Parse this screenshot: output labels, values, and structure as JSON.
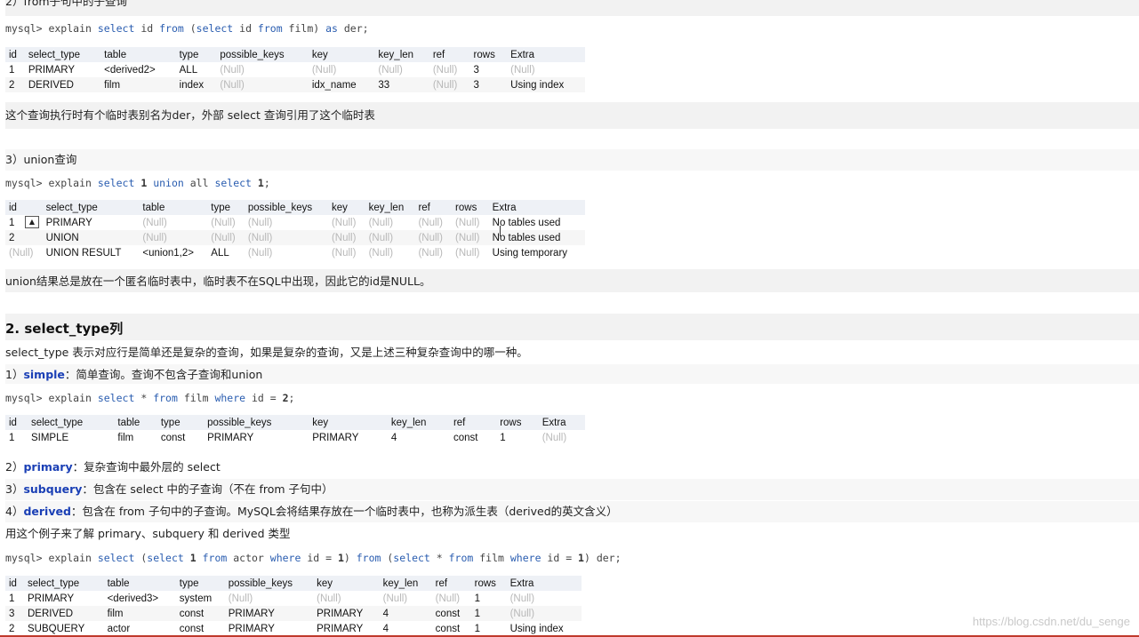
{
  "section_from": {
    "heading": "2）from子句中的子查询",
    "code_prefix": "mysql> explain ",
    "code_k1": "select",
    "code_t1": " id ",
    "code_k2": "from",
    "code_t2": " (",
    "code_k3": "select",
    "code_t3": " id ",
    "code_k4": "from",
    "code_t4": " film) ",
    "code_k5": "as",
    "code_t5": " der;",
    "table": {
      "headers": [
        "id",
        "select_type",
        "table",
        "type",
        "possible_keys",
        "key",
        "key_len",
        "ref",
        "rows",
        "Extra"
      ],
      "rows": [
        [
          "1",
          "PRIMARY",
          "<derived2>",
          "ALL",
          "(Null)",
          "(Null)",
          "(Null)",
          "(Null)",
          "3",
          "(Null)"
        ],
        [
          "2",
          "DERIVED",
          "film",
          "index",
          "(Null)",
          "idx_name",
          "33",
          "(Null)",
          "3",
          "Using index"
        ]
      ]
    },
    "note": "这个查询执行时有个临时表别名为der，外部 select 查询引用了这个临时表"
  },
  "section_union": {
    "heading": "3）union查询",
    "code_prefix": "mysql> explain ",
    "code_k1": "select",
    "code_n1": " 1 ",
    "code_k2": "union",
    "code_t2": " all ",
    "code_k3": "select",
    "code_n2": " 1",
    "code_t3": ";",
    "table": {
      "headers": [
        "id",
        "select_type",
        "table",
        "type",
        "possible_keys",
        "key",
        "key_len",
        "ref",
        "rows",
        "Extra"
      ],
      "rows": [
        [
          "1",
          "PRIMARY",
          "(Null)",
          "(Null)",
          "(Null)",
          "(Null)",
          "(Null)",
          "(Null)",
          "(Null)",
          "No tables used"
        ],
        [
          "2",
          "UNION",
          "(Null)",
          "(Null)",
          "(Null)",
          "(Null)",
          "(Null)",
          "(Null)",
          "(Null)",
          "No tables used"
        ],
        [
          "(Null)",
          "UNION RESULT",
          "<union1,2>",
          "ALL",
          "(Null)",
          "(Null)",
          "(Null)",
          "(Null)",
          "(Null)",
          "Using temporary"
        ]
      ]
    },
    "note": "union结果总是放在一个匿名临时表中，临时表不在SQL中出现，因此它的id是NULL。"
  },
  "section_select_type": {
    "heading": "2. select_type列",
    "intro": "select_type 表示对应行是简单还是复杂的查询，如果是复杂的查询，又是上述三种复杂查询中的哪一种。",
    "simple_prefix": "1）",
    "simple_key": "simple",
    "simple_text": "：简单查询。查询不包含子查询和union",
    "code_prefix": "mysql> explain ",
    "code_k1": "select",
    "code_t1": " * ",
    "code_k2": "from",
    "code_t2": " film ",
    "code_k3": "where",
    "code_t3": " id = ",
    "code_n1": "2",
    "code_t4": ";",
    "table": {
      "headers": [
        "id",
        "select_type",
        "table",
        "type",
        "possible_keys",
        "key",
        "key_len",
        "ref",
        "rows",
        "Extra"
      ],
      "rows": [
        [
          "1",
          "SIMPLE",
          "film",
          "const",
          "PRIMARY",
          "PRIMARY",
          "4",
          "const",
          "1",
          "(Null)"
        ]
      ]
    },
    "primary_prefix": "2）",
    "primary_key": "primary",
    "primary_text": "：复杂查询中最外层的 select",
    "subquery_prefix": "3）",
    "subquery_key": "subquery",
    "subquery_text": "：包含在 select 中的子查询（不在 from 子句中）",
    "derived_prefix": "4）",
    "derived_key": "derived",
    "derived_text": "：包含在 from 子句中的子查询。MySQL会将结果存放在一个临时表中，也称为派生表（derived的英文含义）",
    "example_note": "用这个例子来了解 primary、subquery 和 derived 类型",
    "code2_prefix": "mysql> explain ",
    "code2_k1": "select",
    "code2_t1": " (",
    "code2_k2": "select",
    "code2_n1": " 1 ",
    "code2_k3": "from",
    "code2_t2": " actor ",
    "code2_k4": "where",
    "code2_t3": " id = ",
    "code2_n2": "1",
    "code2_t4": ") ",
    "code2_k5": "from",
    "code2_t5": " (",
    "code2_k6": "select",
    "code2_t6": " * ",
    "code2_k7": "from",
    "code2_t7": " film ",
    "code2_k8": "where",
    "code2_t8": " id = ",
    "code2_n3": "1",
    "code2_t9": ") der;",
    "table2": {
      "headers": [
        "id",
        "select_type",
        "table",
        "type",
        "possible_keys",
        "key",
        "key_len",
        "ref",
        "rows",
        "Extra"
      ],
      "rows": [
        [
          "1",
          "PRIMARY",
          "<derived3>",
          "system",
          "(Null)",
          "(Null)",
          "(Null)",
          "(Null)",
          "1",
          "(Null)"
        ],
        [
          "3",
          "DERIVED",
          "film",
          "const",
          "PRIMARY",
          "PRIMARY",
          "4",
          "const",
          "1",
          "(Null)"
        ],
        [
          "2",
          "SUBQUERY",
          "actor",
          "const",
          "PRIMARY",
          "PRIMARY",
          "4",
          "const",
          "1",
          "Using index"
        ]
      ]
    }
  },
  "watermark": "https://blog.csdn.net/du_senge"
}
